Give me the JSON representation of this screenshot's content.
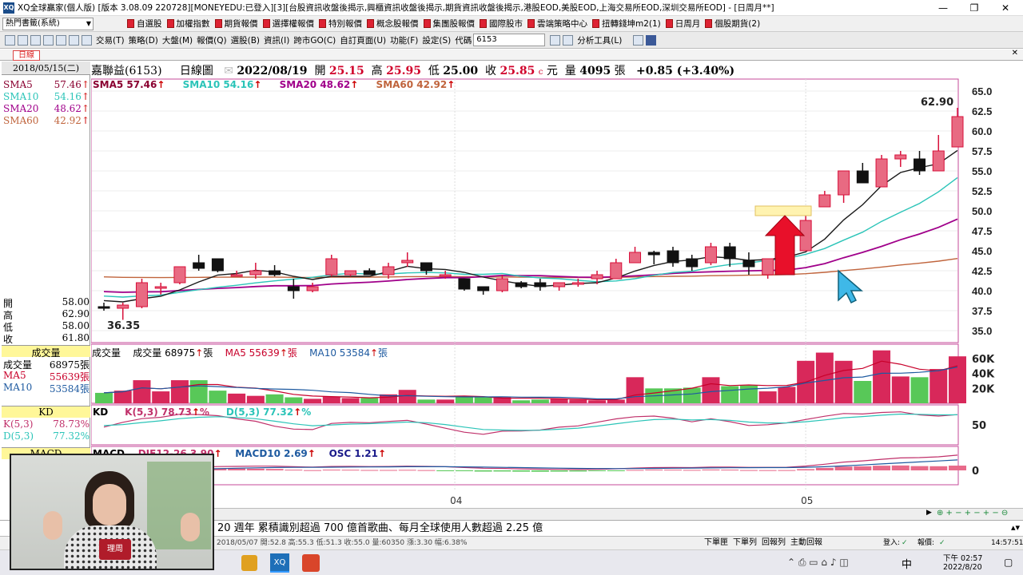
{
  "title": "XQ全球贏家(個人版) [版本 3.08.09 220728][MONEYEDU:已登入][3][台股資訊收盤後揭示,興櫃資訊收盤後揭示,期貨資訊收盤後揭示,港股EOD,美股EOD,上海交易所EOD,深圳交易所EOD] - [日周月**]",
  "window_buttons": [
    "—",
    "❐",
    "✕"
  ],
  "layout_combo": "熱門書籤(系統)",
  "quick_buttons": [
    "自選股",
    "加權指數",
    "期貨報價",
    "選擇權報價",
    "特別報價",
    "概念股報價",
    "集團股報價",
    "國際股市",
    "雲端策略中心",
    "扭轉錢坤m2(1)",
    "日周月",
    "個股期貨(2)"
  ],
  "menus": [
    "交易(T)",
    "策略(D)",
    "大盤(M)",
    "報價(Q)",
    "選股(B)",
    "資訊(I)",
    "跨市GO(C)",
    "自訂頁面(U)",
    "功能(F)",
    "設定(S)"
  ],
  "code_label": "代碼",
  "code_value": "6153",
  "analysis_tool": "分析工具(L)",
  "tab": "日線",
  "left": {
    "date": "2018/05/15(二)",
    "sma": [
      {
        "label": "SMA5",
        "value": "57.46",
        "color": "#8a0030"
      },
      {
        "label": "SMA10",
        "value": "54.16",
        "color": "#2bc4b8"
      },
      {
        "label": "SMA20",
        "value": "48.62",
        "color": "#a0008a"
      },
      {
        "label": "SMA60",
        "value": "42.92",
        "color": "#c0643c"
      }
    ],
    "ohlc": [
      {
        "label": "開",
        "value": "58.00"
      },
      {
        "label": "高",
        "value": "62.90"
      },
      {
        "label": "低",
        "value": "58.00"
      },
      {
        "label": "收",
        "value": "61.80"
      }
    ],
    "vol_title": "成交量",
    "vol": [
      {
        "label": "成交量",
        "value": "68975張",
        "color": "#000"
      },
      {
        "label": "MA5",
        "value": "55639張",
        "color": "#c8002a"
      },
      {
        "label": "MA10",
        "value": "53584張",
        "color": "#1e5aa0"
      }
    ],
    "kd_title": "KD",
    "kd": [
      {
        "label": "K(5,3)",
        "value": "78.73%",
        "color": "#c0306a"
      },
      {
        "label": "D(5,3)",
        "value": "77.32%",
        "color": "#2bc4b8"
      }
    ],
    "macd_title": "MACD"
  },
  "header": {
    "stock": "嘉聯益(6153)",
    "type": "日線圖",
    "date": "2022/08/19",
    "o_l": "開",
    "o": "25.15",
    "h_l": "高",
    "h": "25.95",
    "l_l": "低",
    "l": "25.00",
    "c_l": "收",
    "c": "25.85",
    "unit": "元",
    "v_l": "量",
    "v": "4095",
    "v_u": "張",
    "chg": "+0.85 (+3.40%)"
  },
  "sma_hdr": [
    "SMA5 57.46",
    "SMA10 54.16",
    "SMA20 48.62",
    "SMA60 42.92"
  ],
  "vol_hdr": {
    "a": "成交量",
    "b": "成交量 68975",
    "c": "MA5 55639",
    "d": "MA10 53584",
    "u": "張"
  },
  "kd_hdr": {
    "a": "KD",
    "b": "K(5,3) 78.73",
    "c": "D(5,3) 77.32",
    "u": "%"
  },
  "macd_hdr": {
    "a": "MACD",
    "b": "DIF12-26 3.90",
    "c": "MACD10 2.69",
    "d": "OSC 1.21"
  },
  "price_labels": {
    "high": "62.90",
    "low": "36.35"
  },
  "price_ticks": [
    "65.0",
    "62.5",
    "60.0",
    "57.5",
    "55.0",
    "52.5",
    "50.0",
    "47.5",
    "45.0",
    "42.5",
    "40.0",
    "37.5",
    "35.0"
  ],
  "vol_ticks": [
    "60K",
    "40K",
    "20K"
  ],
  "kd_tick": "50",
  "macd_tick": "0",
  "months": [
    "04",
    "05"
  ],
  "ticker": "20 週年 累積識別超過 700 億首歌曲、每月全球使用人數超過 2.25 億",
  "status": "2018/05/07 開:52.8 高:55.3 低:51.3 收:55.0 量:60350 漲:3.30 幅:6.38%",
  "status_btns": [
    "下單匣",
    "下單列",
    "回報列",
    "主動回報"
  ],
  "login": "登入:",
  "report": "報價:",
  "time_right": "14:57:51",
  "taskbar": {
    "time": "下午 02:57",
    "date": "2022/8/20",
    "ime": "中"
  },
  "webcam_logo": "理周",
  "chart_data": {
    "type": "candlestick",
    "title": "嘉聯益(6153) 日線圖",
    "yrange": [
      33.5,
      66.5
    ],
    "candles": [
      [
        38,
        38.5,
        37.5,
        37.8
      ],
      [
        37.8,
        38.5,
        36.35,
        38.2
      ],
      [
        38,
        41.5,
        37.8,
        41
      ],
      [
        40.5,
        41,
        39.5,
        40.5
      ],
      [
        41,
        43,
        40.8,
        43
      ],
      [
        43.5,
        44.5,
        42.5,
        42.8
      ],
      [
        44,
        44,
        42.3,
        42.5
      ],
      [
        42,
        42.5,
        41.8,
        42
      ],
      [
        42,
        43.5,
        41.5,
        42.5
      ],
      [
        42.5,
        43.2,
        41.8,
        42
      ],
      [
        40.5,
        41.5,
        39,
        40
      ],
      [
        40,
        41,
        39.8,
        40.5
      ],
      [
        42,
        44.5,
        41.8,
        44
      ],
      [
        42,
        42.5,
        41.8,
        42.5
      ],
      [
        42.5,
        42.8,
        42,
        42
      ],
      [
        42,
        43.5,
        41.5,
        43
      ],
      [
        43.5,
        44.8,
        43,
        43.8
      ],
      [
        43.5,
        43.5,
        42,
        42.5
      ],
      [
        42,
        42.5,
        41.5,
        42
      ],
      [
        41.5,
        41.5,
        40,
        40.2
      ],
      [
        40.5,
        40.5,
        39.5,
        40
      ],
      [
        40,
        42,
        39.8,
        41.5
      ],
      [
        41,
        41.2,
        40.3,
        40.5
      ],
      [
        41,
        41.5,
        40,
        40.5
      ],
      [
        40.5,
        41,
        40,
        41
      ],
      [
        41,
        41.5,
        40.5,
        41
      ],
      [
        41.5,
        42.5,
        40.8,
        42
      ],
      [
        41.5,
        44,
        41.5,
        43.5
      ],
      [
        43.5,
        45.5,
        43.5,
        44.8
      ],
      [
        44.8,
        45,
        43.3,
        44.5
      ],
      [
        45,
        45.5,
        43,
        43.5
      ],
      [
        44,
        44.5,
        42.5,
        43
      ],
      [
        43.5,
        46,
        43.2,
        45.5
      ],
      [
        45.5,
        46,
        43,
        44
      ],
      [
        43.8,
        44.8,
        42,
        43
      ],
      [
        42,
        44,
        41.5,
        44
      ],
      [
        44,
        45,
        43.8,
        44.5
      ],
      [
        45,
        50,
        45,
        48.8
      ],
      [
        50.5,
        52.5,
        50.5,
        52
      ],
      [
        52,
        55,
        51,
        55
      ],
      [
        55,
        56,
        54,
        53.5
      ],
      [
        53,
        57,
        53,
        56.5
      ],
      [
        56.5,
        57.5,
        55.5,
        57
      ],
      [
        56.5,
        57.5,
        54.5,
        55
      ],
      [
        55,
        59.5,
        55,
        57.5
      ],
      [
        58,
        62.9,
        58,
        61.8
      ]
    ],
    "volume": [
      14,
      17,
      31,
      16,
      31,
      31,
      17,
      13,
      10,
      12,
      8,
      6,
      9,
      7,
      7,
      12,
      18,
      5,
      5,
      9,
      8,
      8,
      4,
      5,
      6,
      5,
      4,
      5,
      35,
      20,
      20,
      21,
      35,
      23,
      24,
      16,
      22,
      57,
      68,
      57,
      30,
      71,
      36,
      35,
      46,
      63
    ],
    "kd": {
      "K": 78.73,
      "D": 77.32
    },
    "macd": {
      "DIF": 3.9,
      "MACD": 2.69,
      "OSC": 1.21
    }
  }
}
